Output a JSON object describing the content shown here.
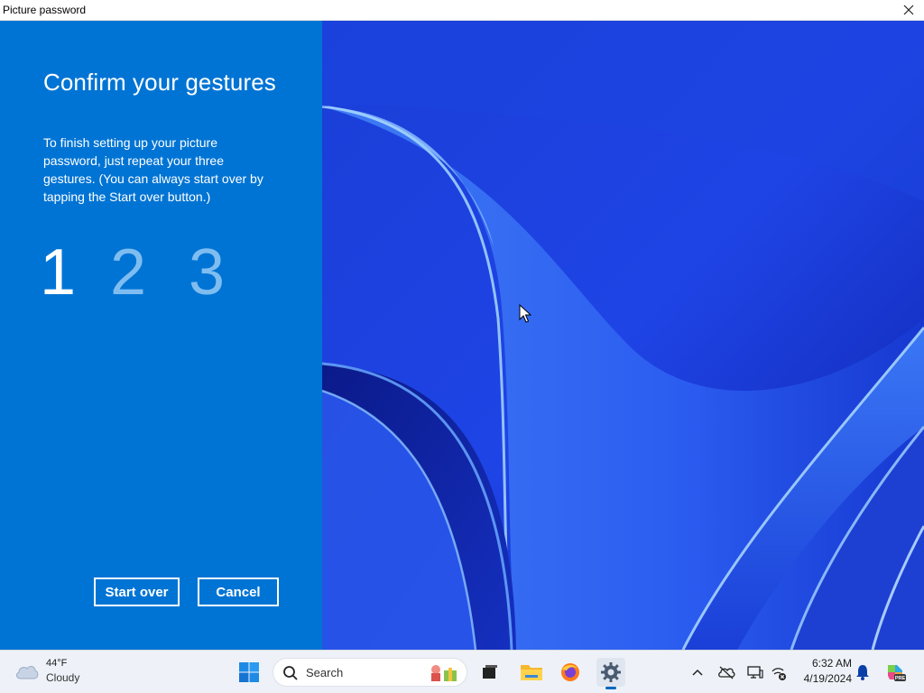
{
  "window": {
    "title": "Picture password"
  },
  "panel": {
    "heading": "Confirm your gestures",
    "description": "To finish setting up your picture password, just repeat your three gestures. (You can always start over by tapping the Start over button.)",
    "gestures": [
      "1",
      "2",
      "3"
    ],
    "active_gesture": 1,
    "start_over_label": "Start over",
    "cancel_label": "Cancel"
  },
  "colors": {
    "panel_bg": "#0074d4",
    "inactive_gesture": "#7fbdf0",
    "wallpaper_base": "#1a3fd8"
  },
  "taskbar": {
    "weather": {
      "temp": "44°F",
      "condition": "Cloudy",
      "icon": "cloud-icon"
    },
    "search_placeholder": "Search",
    "apps": [
      {
        "name": "Start",
        "icon": "windows-icon"
      },
      {
        "name": "Task View",
        "icon": "task-view-icon"
      },
      {
        "name": "File Explorer",
        "icon": "folder-icon"
      },
      {
        "name": "Firefox",
        "icon": "firefox-icon"
      },
      {
        "name": "Settings",
        "icon": "gear-icon",
        "active": true
      }
    ],
    "clock": {
      "time": "6:32 AM",
      "date": "4/19/2024"
    }
  }
}
